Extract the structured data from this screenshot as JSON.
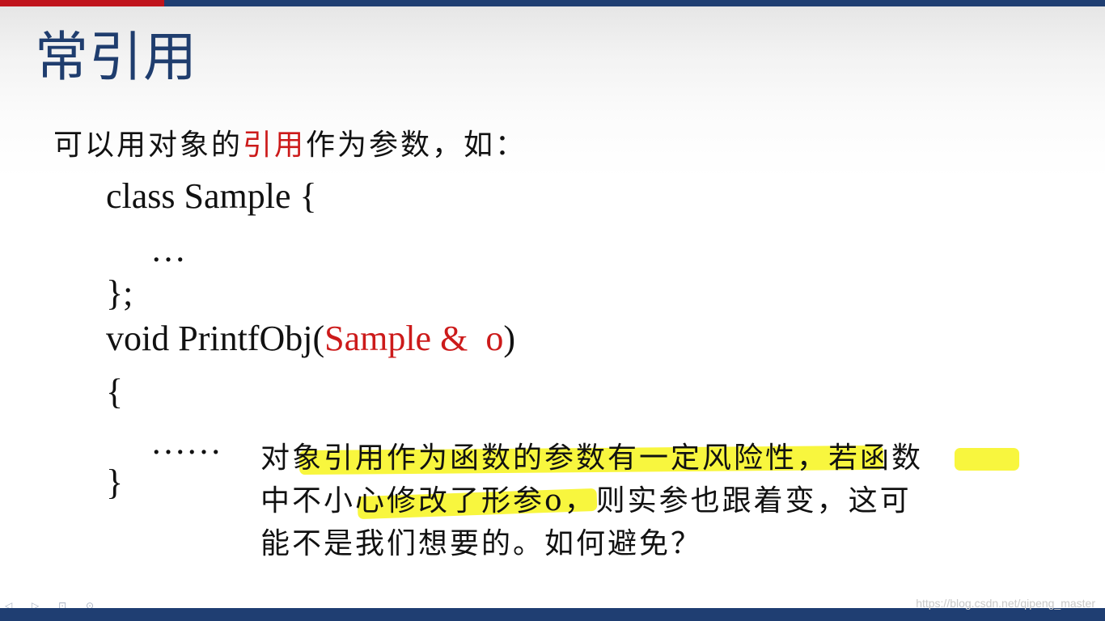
{
  "slide": {
    "title": "常引用",
    "intro": {
      "before": "可以用对象的",
      "highlight": "引用",
      "after": "作为参数，如："
    },
    "code": {
      "line1": "class Sample {",
      "line2": "…",
      "line3": "};",
      "line4_prefix": "void PrintfObj(",
      "line4_param": "Sample &  o",
      "line4_suffix": ")",
      "line5": "{",
      "line6": "……",
      "line7": "}"
    },
    "note": {
      "line1": "对象引用作为函数的参数有一定风险性，若函数",
      "line2": "中不小心修改了形参o，则实参也跟着变，这可",
      "line3": "能不是我们想要的。如何避免？"
    },
    "watermark": "https://blog.csdn.net/qipeng_master",
    "nav_icons": "◁ ▷ ⊡ ⊙"
  },
  "colors": {
    "title": "#1f3d6e",
    "accent_red": "#cc1a1a",
    "top_bar_red": "#c0141c",
    "bar_blue": "#1f3e72",
    "highlighter": "#f7f41c"
  }
}
